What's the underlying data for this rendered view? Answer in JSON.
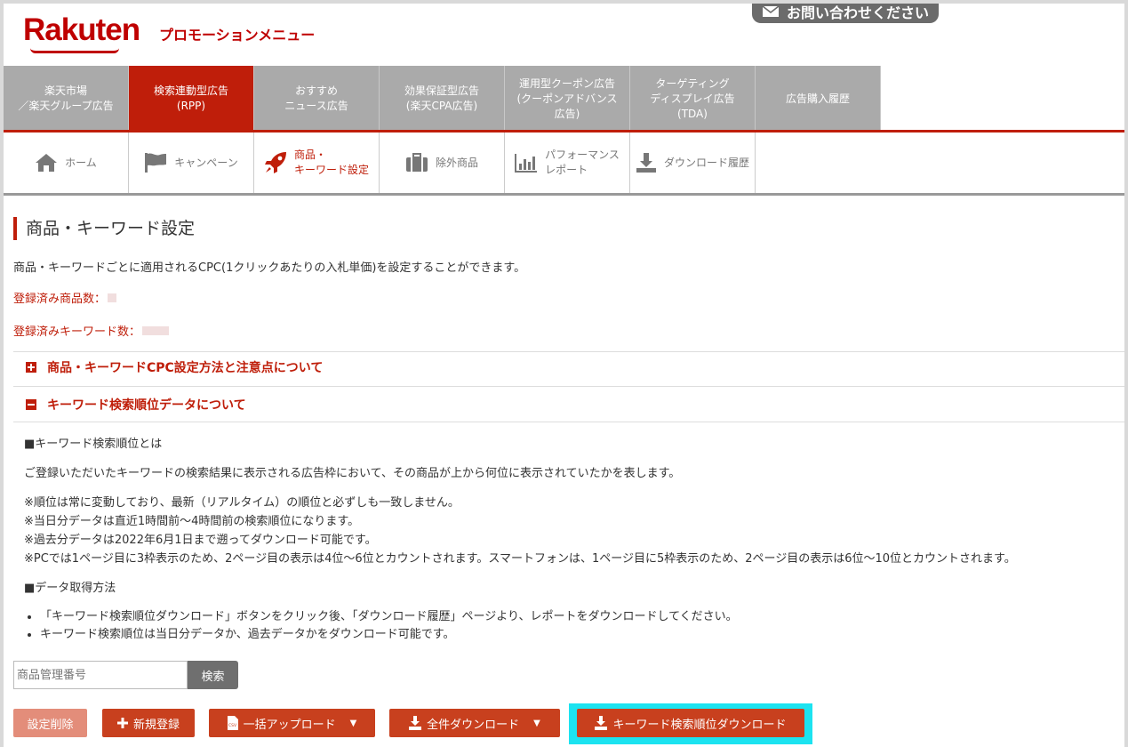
{
  "header": {
    "logo": "Rakuten",
    "subtitle": "プロモーションメニュー",
    "contact": "お問い合わせください"
  },
  "topnav": [
    {
      "label": "楽天市場\n／楽天グループ広告",
      "active": false
    },
    {
      "label": "検索連動型広告\n(RPP)",
      "active": true
    },
    {
      "label": "おすすめ\nニュース広告",
      "active": false
    },
    {
      "label": "効果保証型広告\n(楽天CPA広告)",
      "active": false
    },
    {
      "label": "運用型クーポン広告\n(クーポンアドバンス\n広告)",
      "active": false
    },
    {
      "label": "ターゲティング\nディスプレイ広告\n(TDA)",
      "active": false
    },
    {
      "label": "広告購入履歴",
      "active": false
    }
  ],
  "subnav": [
    {
      "label": "ホーム",
      "icon": "home-icon"
    },
    {
      "label": "キャンペーン",
      "icon": "flag-icon"
    },
    {
      "label": "商品・\nキーワード設定",
      "icon": "rocket-icon"
    },
    {
      "label": "除外商品",
      "icon": "briefcase-icon"
    },
    {
      "label": "パフォーマンス\nレポート",
      "icon": "chart-icon"
    },
    {
      "label": "ダウンロード履歴",
      "icon": "download-icon"
    }
  ],
  "page": {
    "title": "商品・キーワード設定",
    "description": "商品・キーワードごとに適用されるCPC(1クリックあたりの入札単価)を設定することができます。",
    "registered_items": "登録済み商品数：",
    "registered_keywords": "登録済みキーワード数："
  },
  "accordion": {
    "section1": "商品・キーワードCPC設定方法と注意点について",
    "section2": "キーワード検索順位データについて",
    "heading1": "■キーワード検索順位とは",
    "para1": "ご登録いただいたキーワードの検索結果に表示される広告枠において、その商品が上から何位に表示されていたかを表します。",
    "notes": [
      "※順位は常に変動しており、最新（リアルタイム）の順位と必ずしも一致しません。",
      "※当日分データは直近1時間前〜4時間前の検索順位になります。",
      "※過去分データは2022年6月1日まで遡ってダウンロード可能です。",
      "※PCでは1ページ目に3枠表示のため、2ページ目の表示は4位〜6位とカウントされます。スマートフォンは、1ページ目に5枠表示のため、2ページ目の表示は6位〜10位とカウントされます。"
    ],
    "heading2": "■データ取得方法",
    "bullets": [
      "「キーワード検索順位ダウンロード」ボタンをクリック後、「ダウンロード履歴」ページより、レポートをダウンロードしてください。",
      "キーワード検索順位は当日分データか、過去データかをダウンロード可能です。"
    ]
  },
  "search": {
    "placeholder": "商品管理番号",
    "button": "検索"
  },
  "buttons": {
    "delete": "設定削除",
    "new": "新規登録",
    "bulk_upload": "一括アップロード",
    "download_all": "全件ダウンロード",
    "keyword_rank_download": "キーワード検索順位ダウンロード",
    "caret": "▼"
  },
  "colors": {
    "brand": "#bf0000",
    "active_tab": "#bf1e0a",
    "button": "#c8401e",
    "highlight": "#1ce3f0"
  }
}
